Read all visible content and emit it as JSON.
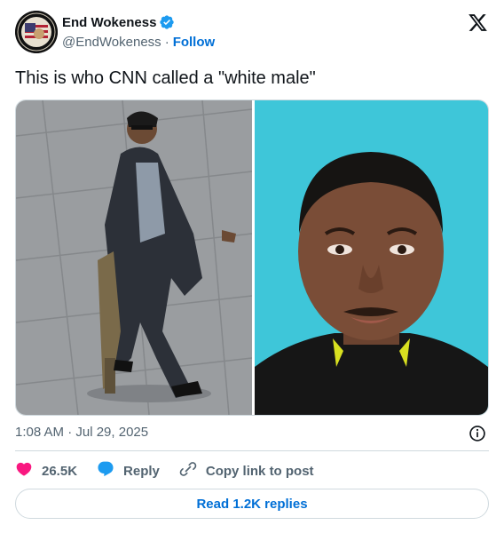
{
  "author": {
    "display_name": "End Wokeness",
    "handle": "@EndWokeness",
    "follow_label": "Follow",
    "separator": "·",
    "avatar_ring_text": "SUPPORT OUR TROOPS"
  },
  "tweet": {
    "text": "This is who CNN called a \"white male\"",
    "timestamp": "1:08 AM · Jul 29, 2025"
  },
  "actions": {
    "likes": "26.5K",
    "reply_label": "Reply",
    "copy_label": "Copy link to post"
  },
  "read_replies_label": "Read 1.2K replies",
  "colors": {
    "accent": "#006fd6",
    "like": "#f91880",
    "verified": "#1d9bf0",
    "photo_bg_right": "#3ec6d9"
  },
  "icons": [
    "verified-badge-icon",
    "x-logo-icon",
    "info-icon",
    "heart-icon",
    "reply-bubble-icon",
    "link-icon"
  ]
}
